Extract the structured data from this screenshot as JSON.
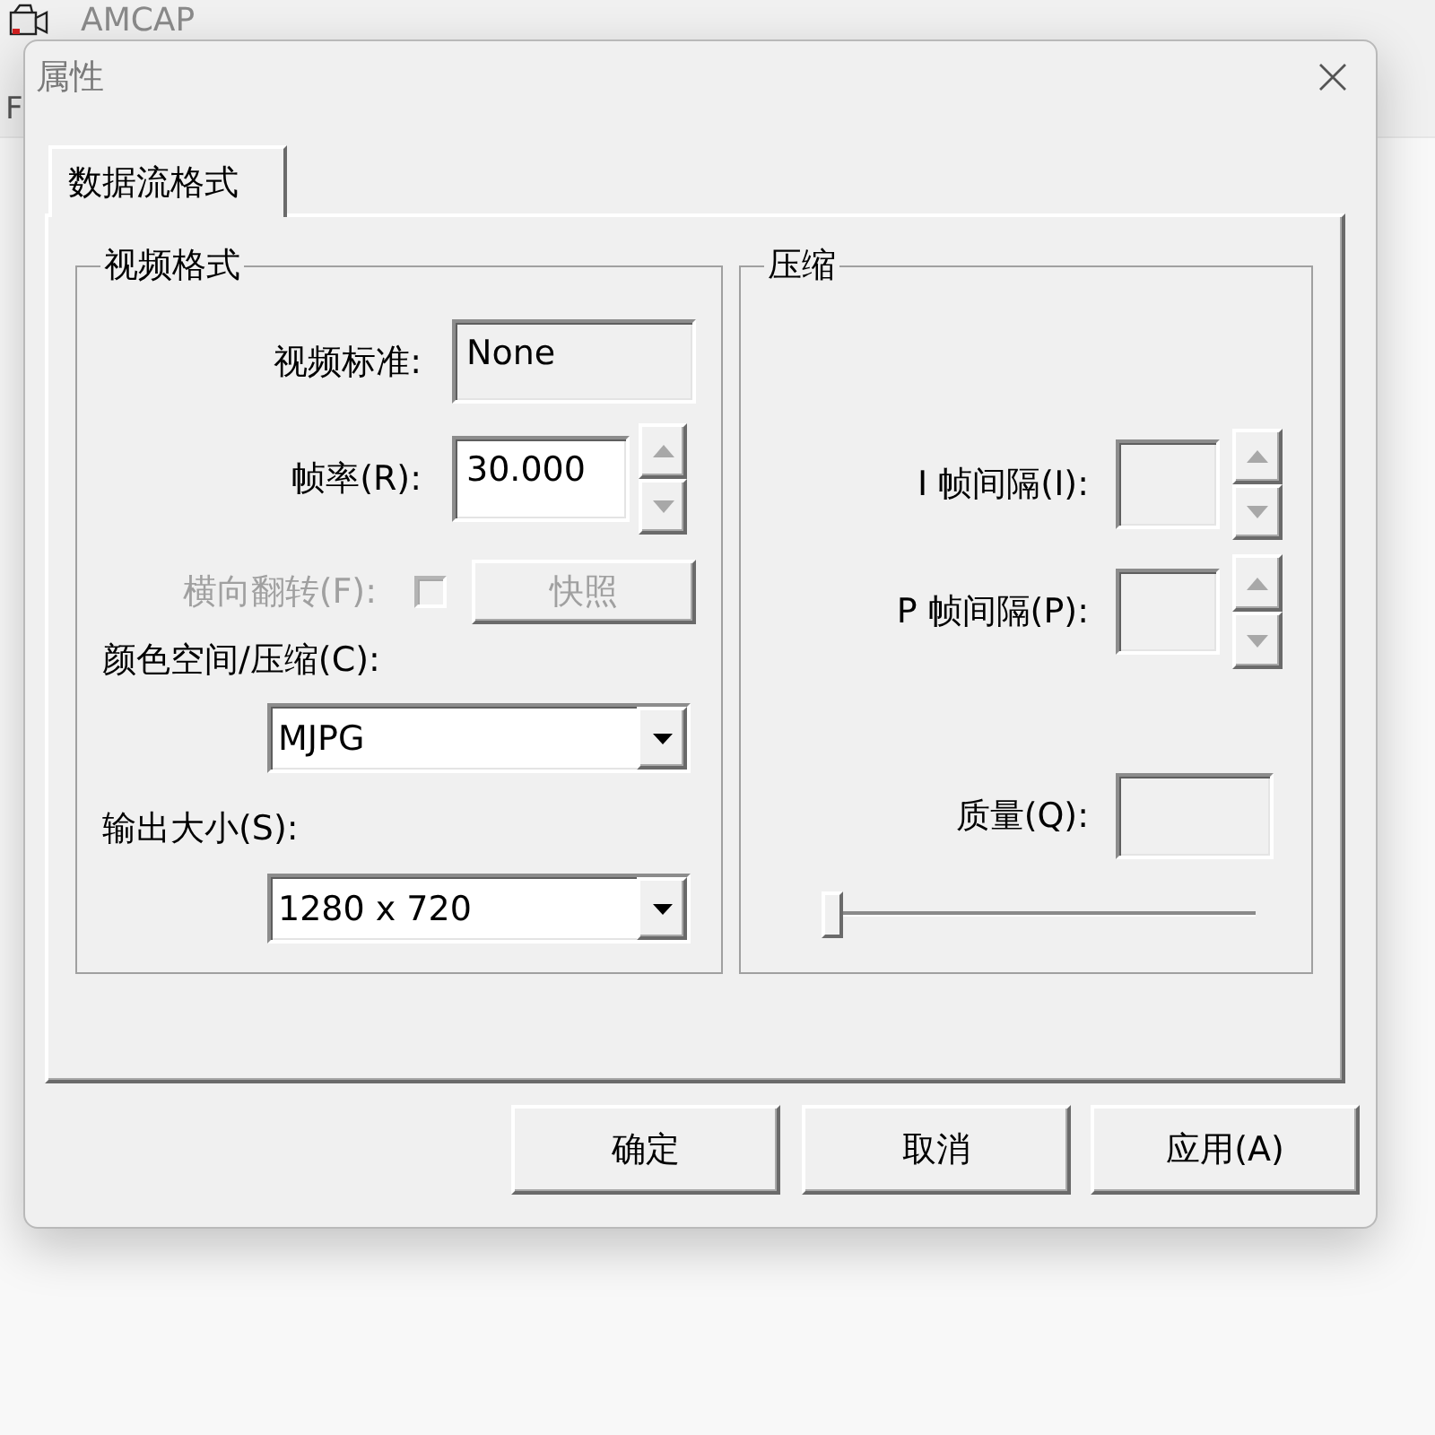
{
  "background_window": {
    "title": "AMCAP",
    "menu_items": [
      "F"
    ]
  },
  "dialog": {
    "title": "属性"
  },
  "tabs": [
    {
      "label": "数据流格式",
      "selected": true
    }
  ],
  "video_format": {
    "title": "视频格式",
    "video_standard": {
      "label": "视频标准:",
      "value": "None",
      "disabled": true
    },
    "frame_rate": {
      "label": "帧率(R):",
      "value": "30.000",
      "disabled": false
    },
    "flip_horizontal": {
      "label": "横向翻转(F):",
      "checked": false,
      "disabled": true
    },
    "snapshot_button": {
      "label": "快照",
      "disabled": true
    },
    "color_space": {
      "label": "颜色空间/压缩(C):",
      "value": "MJPG"
    },
    "output_size": {
      "label": "输出大小(S):",
      "value": "1280 x 720"
    }
  },
  "compression": {
    "title": "压缩",
    "i_frame_interval": {
      "label": "I 帧间隔(I):",
      "disabled": true
    },
    "p_frame_interval": {
      "label": "P 帧间隔(P):",
      "disabled": true
    },
    "quality": {
      "label": "质量(Q):",
      "disabled": true,
      "level": 0
    }
  },
  "buttons": [
    {
      "label": "确定"
    },
    {
      "label": "取消"
    },
    {
      "label": "应用(A)"
    }
  ]
}
